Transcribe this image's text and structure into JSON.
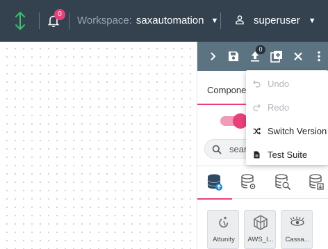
{
  "header": {
    "notification_count": "0",
    "workspace_label": "Workspace:",
    "workspace_name": "saxautomation",
    "username": "superuser",
    "accent_color": "#35c46a"
  },
  "panel_toolbar": {
    "upload_badge": "0",
    "buttons": [
      "expand",
      "save",
      "upload",
      "add-component",
      "close",
      "more"
    ]
  },
  "panel": {
    "components_tab": "Componen",
    "search_placeholder": "search",
    "toggle_on": true,
    "category_icons": [
      "data-source-icon",
      "data-processor-icon",
      "data-analytics-icon",
      "data-sink-icon"
    ]
  },
  "components": [
    {
      "label": "Attunity",
      "icon": "attunity-icon"
    },
    {
      "label": "AWS_I...",
      "icon": "aws-icon"
    },
    {
      "label": "Cassa...",
      "icon": "cassandra-icon"
    }
  ],
  "menu": {
    "items": [
      {
        "label": "Undo",
        "icon": "undo-icon",
        "enabled": false
      },
      {
        "label": "Redo",
        "icon": "redo-icon",
        "enabled": false
      },
      {
        "label": "Switch Version",
        "icon": "shuffle-icon",
        "enabled": true
      },
      {
        "label": "Test Suite",
        "icon": "document-icon",
        "enabled": true
      }
    ]
  },
  "colors": {
    "topbar": "#34424f",
    "panel_toolbar": "#5c7481",
    "accent": "#e9407a"
  }
}
